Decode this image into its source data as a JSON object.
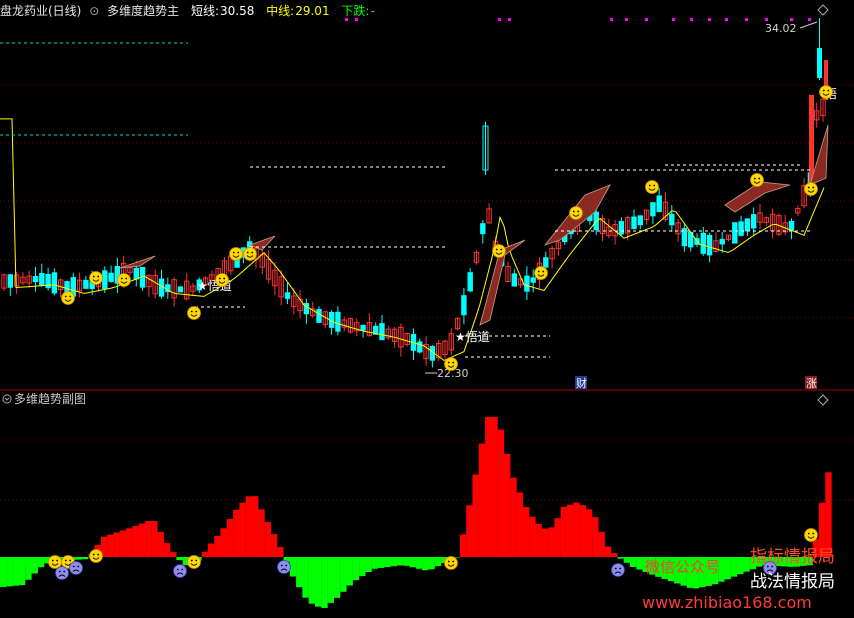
{
  "header": {
    "stock_name": "盘龙药业(日线)",
    "indicator_name": "多维度趋势主",
    "short_label": "短线:",
    "short_value": "30.58",
    "mid_label": "中线:",
    "mid_value": "29.01",
    "trend_label": "下跌:",
    "trend_value": "-"
  },
  "price_labels": {
    "high": "34.02",
    "low": "22.30"
  },
  "signal_labels": {
    "wudao": "悟道",
    "wudao_short": "悟"
  },
  "badges": {
    "cai": "财",
    "zhang": "涨"
  },
  "sub_chart": {
    "title": "多维趋势副图"
  },
  "watermark": {
    "line1": "指标情报局",
    "line2": "战法情报局",
    "line3": "微信公众号",
    "url": "www.zhibiao168.com"
  },
  "colors": {
    "up": "#ff3232",
    "down": "#00ffff",
    "line": "#ffff00",
    "band": "#8b2a22",
    "hist_up": "#ff0000",
    "hist_down": "#00ff00",
    "dotted": "#00ffff",
    "grid": "#7a0000"
  }
}
